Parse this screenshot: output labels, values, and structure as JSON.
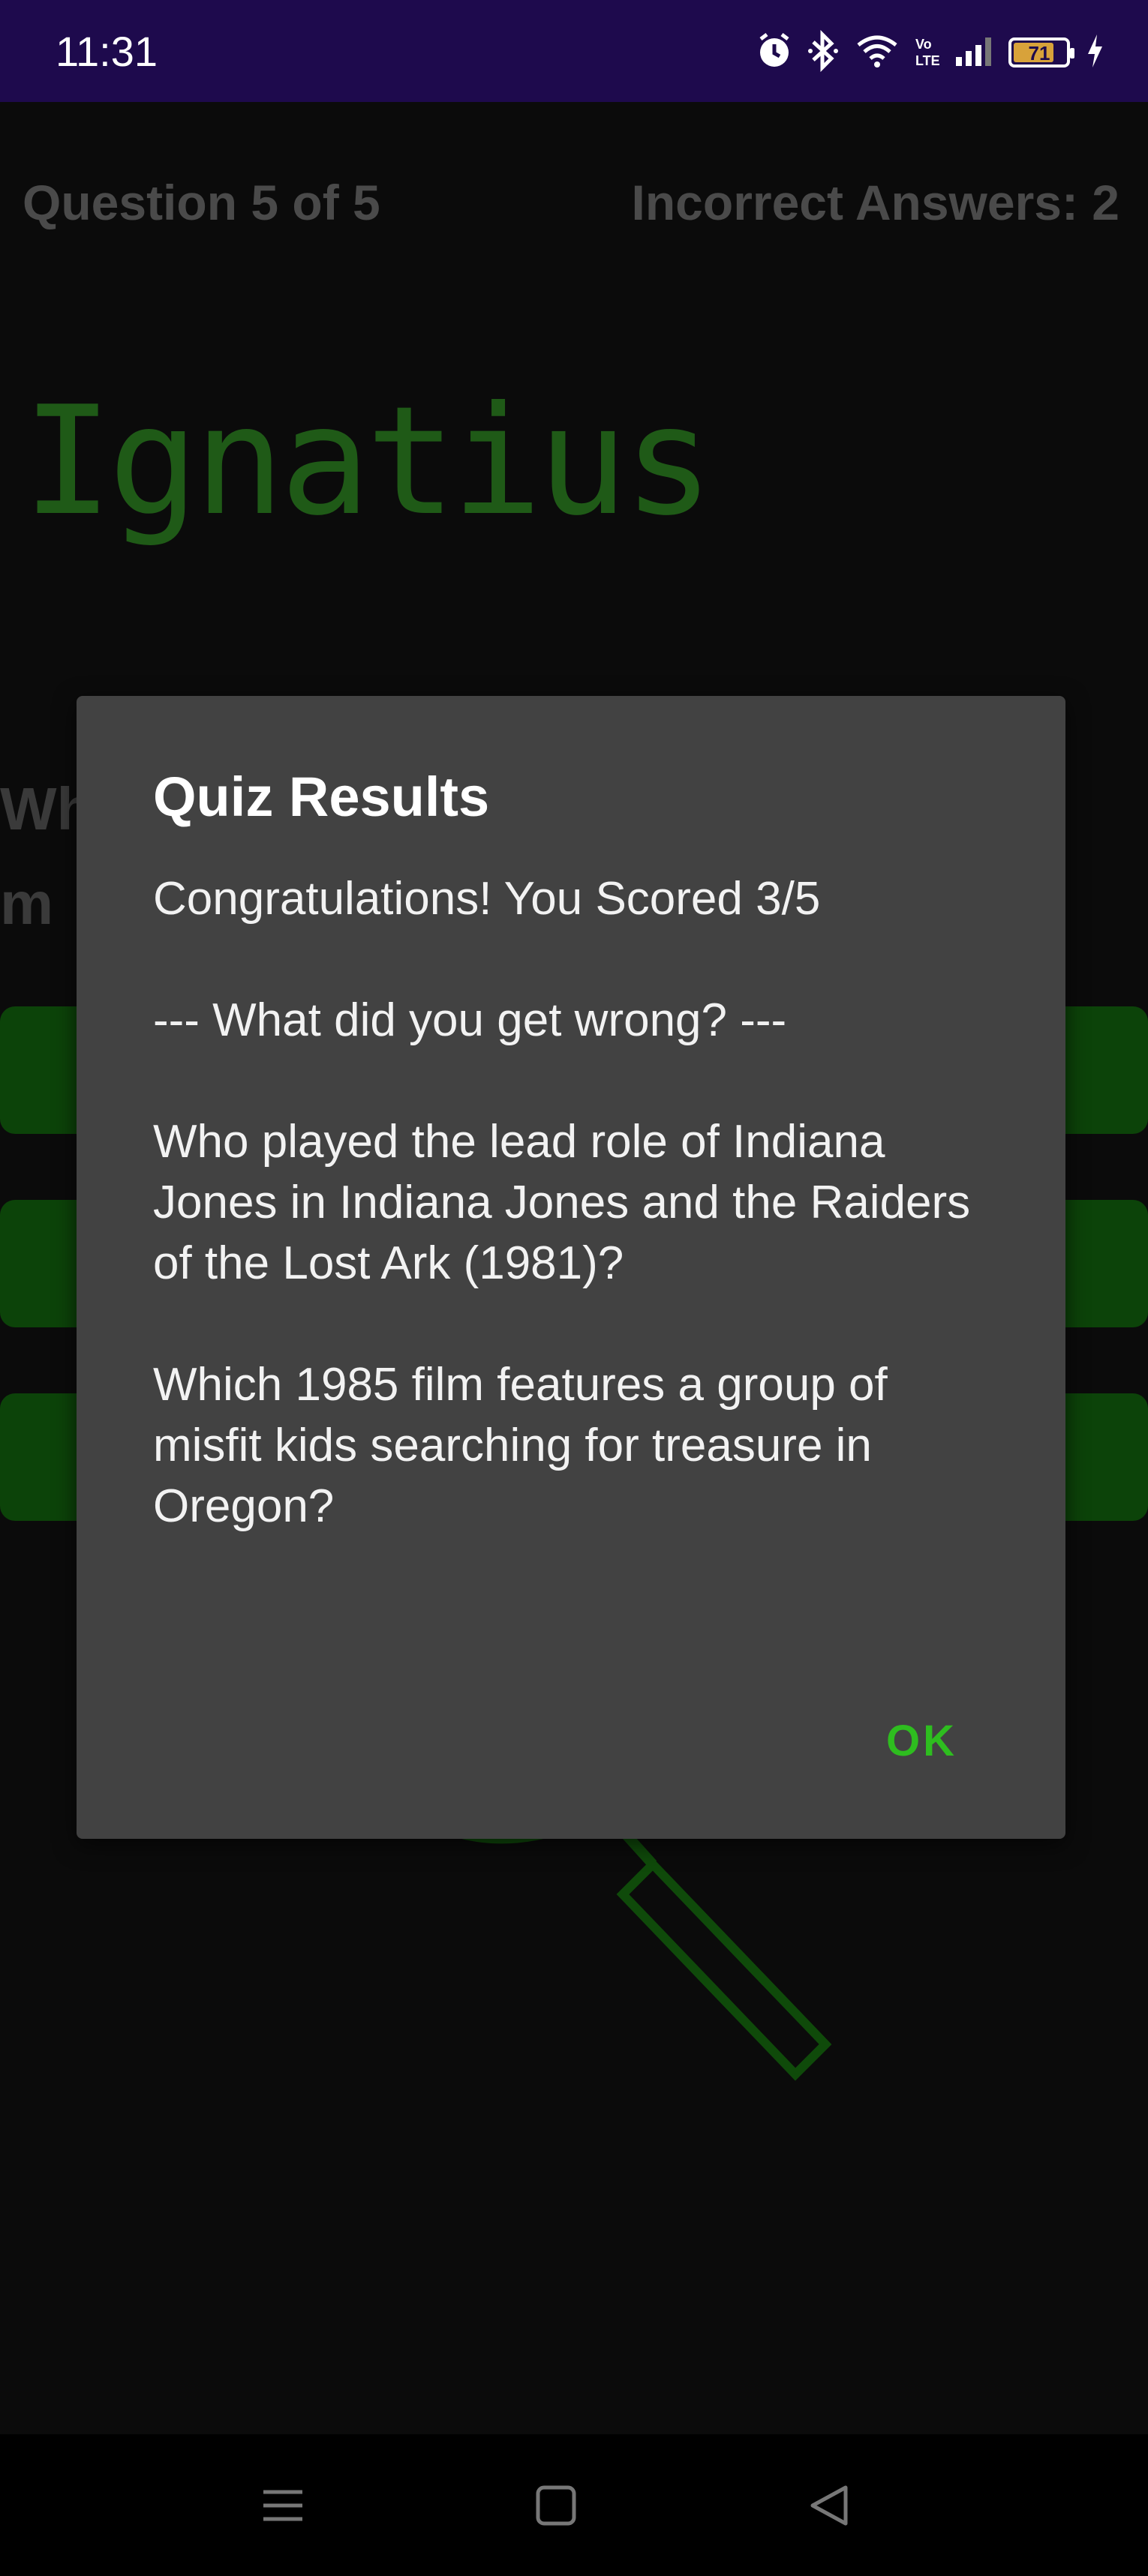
{
  "status_bar": {
    "time": "11:31",
    "battery": "71",
    "icons": [
      "alarm-icon",
      "bluetooth-icon",
      "wifi-icon",
      "volte-icon",
      "signal-icon",
      "battery-icon",
      "charging-icon"
    ]
  },
  "background": {
    "question_counter": "Question 5 of 5",
    "incorrect_answers": "Incorrect Answers: 2",
    "logo_text": "Ignatius",
    "question_partial": "Wh\nm",
    "answer_buttons": [
      "",
      "",
      ""
    ],
    "accent_color": "#1f7a14"
  },
  "dialog": {
    "title": "Quiz Results",
    "message": "Congratulations! You Scored 3/5\n\n--- What did you get wrong? ---\n\nWho played the lead role of Indiana Jones in Indiana Jones and the Raiders of the Lost Ark (1981)?\n\nWhich 1985 film features a group of misfit kids searching for treasure in Oregon?",
    "ok_label": "OK",
    "ok_color": "#2ebd1f"
  },
  "nav_bar": {
    "buttons": [
      "menu-icon",
      "home-icon",
      "back-icon"
    ]
  }
}
